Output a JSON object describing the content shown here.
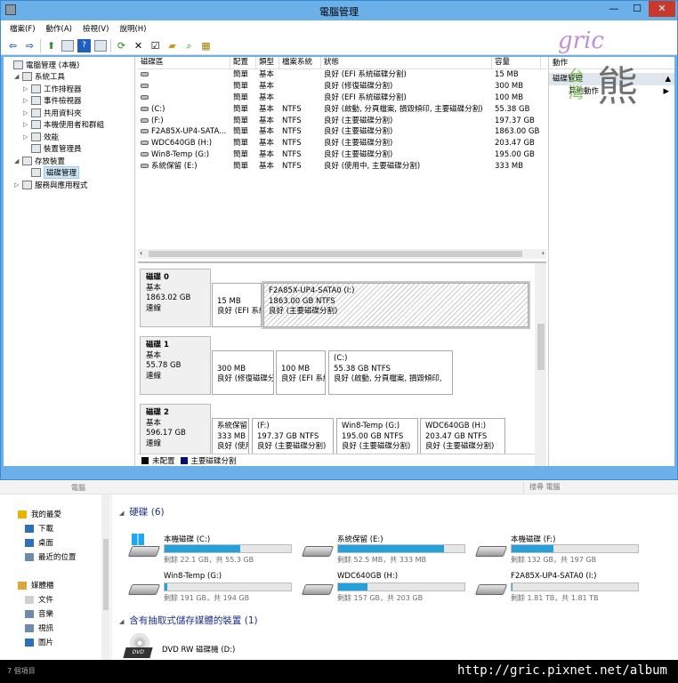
{
  "cm": {
    "title": "電腦管理",
    "menu": [
      "檔案(F)",
      "動作(A)",
      "檢視(V)",
      "說明(H)"
    ],
    "tree": [
      {
        "label": "電腦管理 (本機)",
        "level": 0,
        "exp": ""
      },
      {
        "label": "系統工具",
        "level": 1,
        "exp": "◢"
      },
      {
        "label": "工作排程器",
        "level": 2,
        "exp": "▷"
      },
      {
        "label": "事件檢視器",
        "level": 2,
        "exp": "▷"
      },
      {
        "label": "共用資料夾",
        "level": 2,
        "exp": "▷"
      },
      {
        "label": "本機使用者和群組",
        "level": 2,
        "exp": "▷"
      },
      {
        "label": "效能",
        "level": 2,
        "exp": "▷"
      },
      {
        "label": "裝置管理員",
        "level": 2,
        "exp": ""
      },
      {
        "label": "存放裝置",
        "level": 1,
        "exp": "◢"
      },
      {
        "label": "磁碟管理",
        "level": 2,
        "exp": "",
        "selected": true
      },
      {
        "label": "服務與應用程式",
        "level": 1,
        "exp": "▷"
      }
    ],
    "vol_headers": [
      "磁碟區",
      "配置",
      "類型",
      "檔案系統",
      "狀態",
      "容量"
    ],
    "vol_rows": [
      [
        "",
        "簡單",
        "基本",
        "",
        "良好 (EFI 系統磁碟分割)",
        "15 MB"
      ],
      [
        "",
        "簡單",
        "基本",
        "",
        "良好 (修復磁碟分割)",
        "300 MB"
      ],
      [
        "",
        "簡單",
        "基本",
        "",
        "良好 (EFI 系統磁碟分割)",
        "100 MB"
      ],
      [
        "(C:)",
        "簡單",
        "基本",
        "NTFS",
        "良好 (啟動, 分頁檔案, 損毀傾印, 主要磁碟分割)",
        "55.38 GB"
      ],
      [
        "(F:)",
        "簡單",
        "基本",
        "NTFS",
        "良好 (主要磁碟分割)",
        "197.37 GB"
      ],
      [
        "F2A85X-UP4-SATA...",
        "簡單",
        "基本",
        "NTFS",
        "良好 (主要磁碟分割)",
        "1863.00 GB"
      ],
      [
        "WDC640GB (H:)",
        "簡單",
        "基本",
        "NTFS",
        "良好 (主要磁碟分割)",
        "203.47 GB"
      ],
      [
        "Win8-Temp (G:)",
        "簡單",
        "基本",
        "NTFS",
        "良好 (主要磁碟分割)",
        "195.00 GB"
      ],
      [
        "系統保留 (E:)",
        "簡單",
        "基本",
        "NTFS",
        "良好 (使用中, 主要磁碟分割)",
        "333 MB"
      ]
    ],
    "disks": [
      {
        "name": "磁碟 0",
        "type": "基本",
        "size": "1863.02 GB",
        "state": "連線",
        "parts": [
          {
            "l1": "",
            "l2": "15 MB",
            "l3": "良好 (EFI 系統磁碟分割)",
            "hatch": false
          },
          {
            "l1": "F2A85X-UP4-SATA0  (I:)",
            "l2": "1863.00 GB NTFS",
            "l3": "良好 (主要磁碟分割)",
            "hatch": true
          }
        ]
      },
      {
        "name": "磁碟 1",
        "type": "基本",
        "size": "55.78 GB",
        "state": "連線",
        "parts": [
          {
            "l1": "",
            "l2": "300 MB",
            "l3": "良好 (修復磁碟分割)",
            "hatch": false
          },
          {
            "l1": "",
            "l2": "100 MB",
            "l3": "良好 (EFI 系統磁碟分割)",
            "hatch": false
          },
          {
            "l1": "(C:)",
            "l2": "55.38 GB NTFS",
            "l3": "良好 (啟動, 分頁檔案, 損毀傾印,",
            "hatch": false
          }
        ]
      },
      {
        "name": "磁碟 2",
        "type": "基本",
        "size": "596.17 GB",
        "state": "連線",
        "parts": [
          {
            "l1": "系統保留",
            "l2": "333 MB",
            "l3": "良好 (使用中, 主要磁碟分割)",
            "hatch": false
          },
          {
            "l1": "(F:)",
            "l2": "197.37 GB NTFS",
            "l3": "良好 (主要磁碟分割)",
            "hatch": false
          },
          {
            "l1": "Win8-Temp  (G:)",
            "l2": "195.00 GB NTFS",
            "l3": "良好 (主要磁碟分割)",
            "hatch": false
          },
          {
            "l1": "WDC640GB  (H:)",
            "l2": "203.47 GB NTFS",
            "l3": "良好 (主要磁碟分割)",
            "hatch": false
          }
        ]
      }
    ],
    "legend": [
      {
        "label": "未配置",
        "color": "#000000"
      },
      {
        "label": "主要磁碟分割",
        "color": "#000f7a"
      }
    ],
    "actions": {
      "header": "動作",
      "section": "磁碟管理",
      "more": "其他動作"
    },
    "watermark": {
      "gric": "gric",
      "bear": "熊",
      "tw": [
        "台",
        "灣"
      ]
    }
  },
  "ex": {
    "address": "電腦",
    "search": "搜尋 電腦",
    "nav": [
      {
        "label": "我的最愛",
        "sub": false,
        "color": "#e8b400"
      },
      {
        "label": "下載",
        "sub": true,
        "color": "#2f6fb7"
      },
      {
        "label": "桌面",
        "sub": true,
        "color": "#2f6fb7"
      },
      {
        "label": "最近的位置",
        "sub": true,
        "color": "#6d8cab"
      },
      {
        "label": "",
        "sub": false,
        "color": ""
      },
      {
        "label": "媒體櫃",
        "sub": false,
        "color": "#d9a640"
      },
      {
        "label": "文件",
        "sub": true,
        "color": "#cfcfcf"
      },
      {
        "label": "音樂",
        "sub": true,
        "color": "#6d8cab"
      },
      {
        "label": "視訊",
        "sub": true,
        "color": "#6d8cab"
      },
      {
        "label": "圖片",
        "sub": true,
        "color": "#2f6fb7"
      }
    ],
    "group1": "硬碟 (6)",
    "drives": [
      {
        "name": "本機磁碟 (C:)",
        "free": "剩餘 22.1 GB，共 55.3 GB",
        "used": 0.6,
        "win": true
      },
      {
        "name": "系統保留 (E:)",
        "free": "剩餘 52.5 MB，共 333 MB",
        "used": 0.84,
        "win": false
      },
      {
        "name": "本機磁碟 (F:)",
        "free": "剩餘 132 GB，共 197 GB",
        "used": 0.33,
        "win": false
      },
      {
        "name": "Win8-Temp (G:)",
        "free": "剩餘 191 GB，共 194 GB",
        "used": 0.02,
        "win": false
      },
      {
        "name": "WDC640GB (H:)",
        "free": "剩餘 157 GB，共 203 GB",
        "used": 0.23,
        "win": false
      },
      {
        "name": "F2A85X-UP4-SATA0 (I:)",
        "free": "剩餘 1.81 TB，共 1.81 TB",
        "used": 0.01,
        "win": false
      }
    ],
    "group2": "含有抽取式儲存媒體的裝置 (1)",
    "dvd": {
      "name": "DVD RW 磁碟機 (D:)",
      "badge": "DVD"
    },
    "status": "7 個項目",
    "url": "http://gric.pixnet.net/album"
  }
}
